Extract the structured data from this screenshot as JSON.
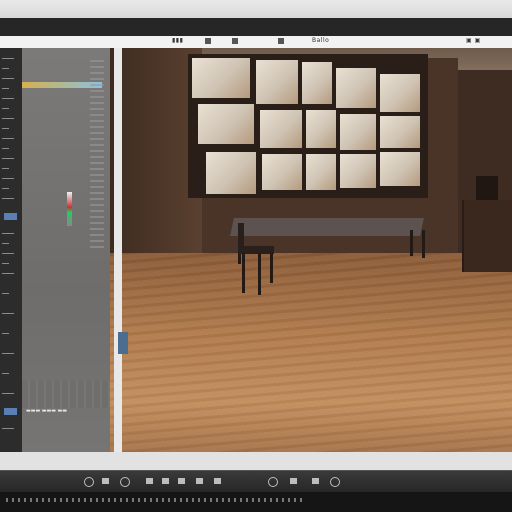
{
  "menubar": {
    "menu_left": "▮▮▮",
    "menu_mid": "Ballo",
    "menu_right": "▣ ▣"
  },
  "panel": {
    "footer_text": "▬▬▬ ▬▬▬ ▬▬"
  },
  "colors": {
    "panel": "#767472",
    "viewport_floor": "#b07a4c",
    "toolbar": "#2f2f2f"
  },
  "icons": [
    "play-icon",
    "record-icon",
    "loop-icon",
    "marker-icon",
    "settings-icon"
  ]
}
